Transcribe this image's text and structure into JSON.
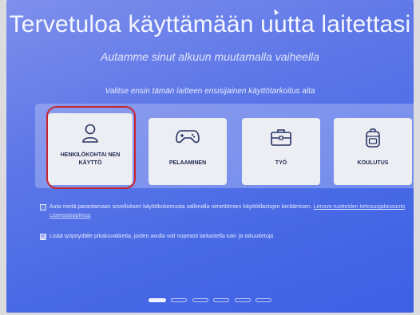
{
  "header": {
    "title": "Tervetuloa käyttämään uutta laitettasi",
    "subtitle": "Autamme sinut alkuun muutamalla vaiheella",
    "instruction": "Valitse ensin tämän laitteen ensisijainen käyttötarkoitus alta"
  },
  "cards": [
    {
      "label": "HENKILÖKOHTAI NEN KÄYTTÖ",
      "icon": "person-icon",
      "selected": true
    },
    {
      "label": "PELAAMINEN",
      "icon": "gamepad-icon",
      "selected": false
    },
    {
      "label": "TYÖ",
      "icon": "briefcase-icon",
      "selected": false
    },
    {
      "label": "KOULUTUS",
      "icon": "backpack-icon",
      "selected": false
    }
  ],
  "options": {
    "telemetry": {
      "checked": false,
      "text": "Auta meitä parantamaan sovelluksen käyttökokemusta sallimalla nimettömien käyttötilastojen keräämisen.",
      "link_privacy": "Lenovo-tuotteiden tietosuojalausunto",
      "link_license": "Lisenssisopimus"
    },
    "shortcuts": {
      "checked": true,
      "text": "Lisää työpöydälle pikakuvakkeita, joiden avulla voit nopeasti tarkastella tuki- ja takuutietoja"
    }
  },
  "pager": {
    "total": 6,
    "current": 1
  },
  "colors": {
    "background": "#4a6be6",
    "card": "#eceef3",
    "card_text": "#222a52",
    "selection_ring": "#c8242e"
  }
}
